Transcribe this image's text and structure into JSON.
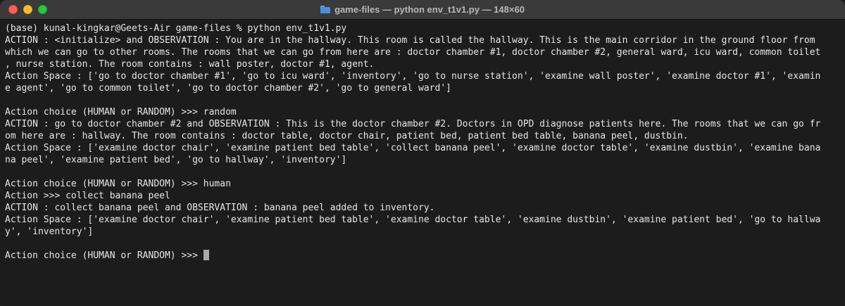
{
  "window": {
    "title": "game-files — python env_t1v1.py — 148×60"
  },
  "terminal": {
    "lines": [
      "(base) kunal-kingkar@Geets-Air game-files % python env_t1v1.py",
      "ACTION : <initialize> and OBSERVATION : You are in the hallway. This room is called the hallway. This is the main corridor in the ground floor from",
      "which we can go to other rooms. The rooms that we can go from here are : doctor chamber #1, doctor chamber #2, general ward, icu ward, common toilet",
      ", nurse station. The room contains : wall poster, doctor #1, agent.",
      "Action Space : ['go to doctor chamber #1', 'go to icu ward', 'inventory', 'go to nurse station', 'examine wall poster', 'examine doctor #1', 'examin",
      "e agent', 'go to common toilet', 'go to doctor chamber #2', 'go to general ward']",
      "",
      "Action choice (HUMAN or RANDOM) >>> random",
      "ACTION : go to doctor chamber #2 and OBSERVATION : This is the doctor chamber #2. Doctors in OPD diagnose patients here. The rooms that we can go fr",
      "om here are : hallway. The room contains : doctor table, doctor chair, patient bed, patient bed table, banana peel, dustbin.",
      "Action Space : ['examine doctor chair', 'examine patient bed table', 'collect banana peel', 'examine doctor table', 'examine dustbin', 'examine bana",
      "na peel', 'examine patient bed', 'go to hallway', 'inventory']",
      "",
      "Action choice (HUMAN or RANDOM) >>> human",
      "Action >>> collect banana peel",
      "ACTION : collect banana peel and OBSERVATION : banana peel added to inventory.",
      "Action Space : ['examine doctor chair', 'examine patient bed table', 'examine doctor table', 'examine dustbin', 'examine patient bed', 'go to hallwa",
      "y', 'inventory']",
      "",
      "Action choice (HUMAN or RANDOM) >>> "
    ]
  }
}
